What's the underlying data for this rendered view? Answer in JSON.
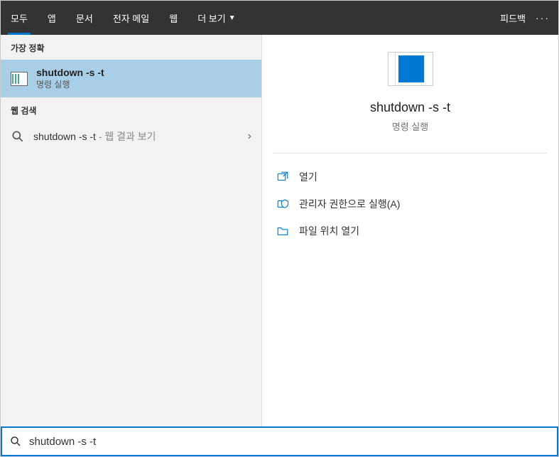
{
  "header": {
    "tabs": [
      {
        "label": "모두",
        "active": true
      },
      {
        "label": "앱"
      },
      {
        "label": "문서"
      },
      {
        "label": "전자 메일"
      },
      {
        "label": "웹"
      },
      {
        "label": "더 보기"
      }
    ],
    "feedback": "피드백"
  },
  "left": {
    "bestMatchHeader": "가장 정확",
    "bestMatch": {
      "title": "shutdown -s -t",
      "subtitle": "명령 실행"
    },
    "webHeader": "웹 검색",
    "webItem": {
      "query": "shutdown -s -t",
      "suffix": " - 웹 결과 보기"
    }
  },
  "preview": {
    "title": "shutdown -s -t",
    "subtitle": "명령 실행"
  },
  "actions": [
    {
      "label": "열기",
      "icon": "open"
    },
    {
      "label": "관리자 권한으로 실행(A)",
      "icon": "admin"
    },
    {
      "label": "파일 위치 열기",
      "icon": "folder"
    }
  ],
  "search": {
    "value": "shutdown -s -t"
  }
}
